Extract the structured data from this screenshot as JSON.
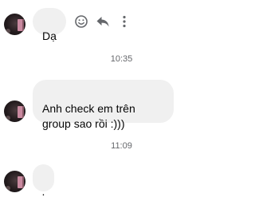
{
  "messages": [
    {
      "text": "Dạ"
    },
    {
      "text": "Anh check em trên\ngroup sao rồi :)))"
    },
    {
      "text": "."
    }
  ],
  "timestamps": [
    "10:35",
    "11:09"
  ],
  "actions": {
    "react_icon": "smiley-icon",
    "reply_icon": "reply-icon",
    "more_icon": "more-vertical-icon"
  },
  "colors": {
    "bubble": "#f0f0f0",
    "icon": "#65676b",
    "timestamp": "#65676b"
  }
}
